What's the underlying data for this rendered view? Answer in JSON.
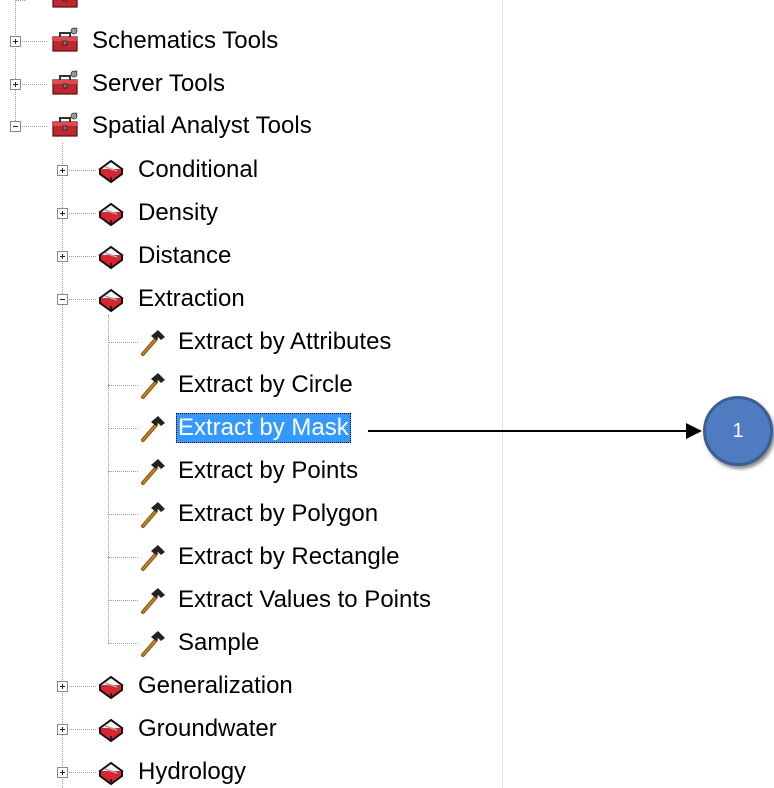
{
  "tree": {
    "toolboxes": [
      {
        "label": "Schematics Tools"
      },
      {
        "label": "Server Tools"
      },
      {
        "label": "Spatial Analyst Tools"
      }
    ],
    "toolsets": [
      {
        "label": "Conditional"
      },
      {
        "label": "Density"
      },
      {
        "label": "Distance"
      },
      {
        "label": "Extraction"
      }
    ],
    "tools": [
      {
        "label": "Extract by Attributes"
      },
      {
        "label": "Extract by Circle"
      },
      {
        "label": "Extract by Mask"
      },
      {
        "label": "Extract by Points"
      },
      {
        "label": "Extract by Polygon"
      },
      {
        "label": "Extract by Rectangle"
      },
      {
        "label": "Extract Values to Points"
      },
      {
        "label": "Sample"
      }
    ],
    "more_toolsets": [
      {
        "label": "Generalization"
      },
      {
        "label": "Groundwater"
      },
      {
        "label": "Hydrology"
      }
    ]
  },
  "callout": {
    "number": "1"
  },
  "colors": {
    "selection": "#3399ff",
    "callout": "#4f7cc0"
  }
}
